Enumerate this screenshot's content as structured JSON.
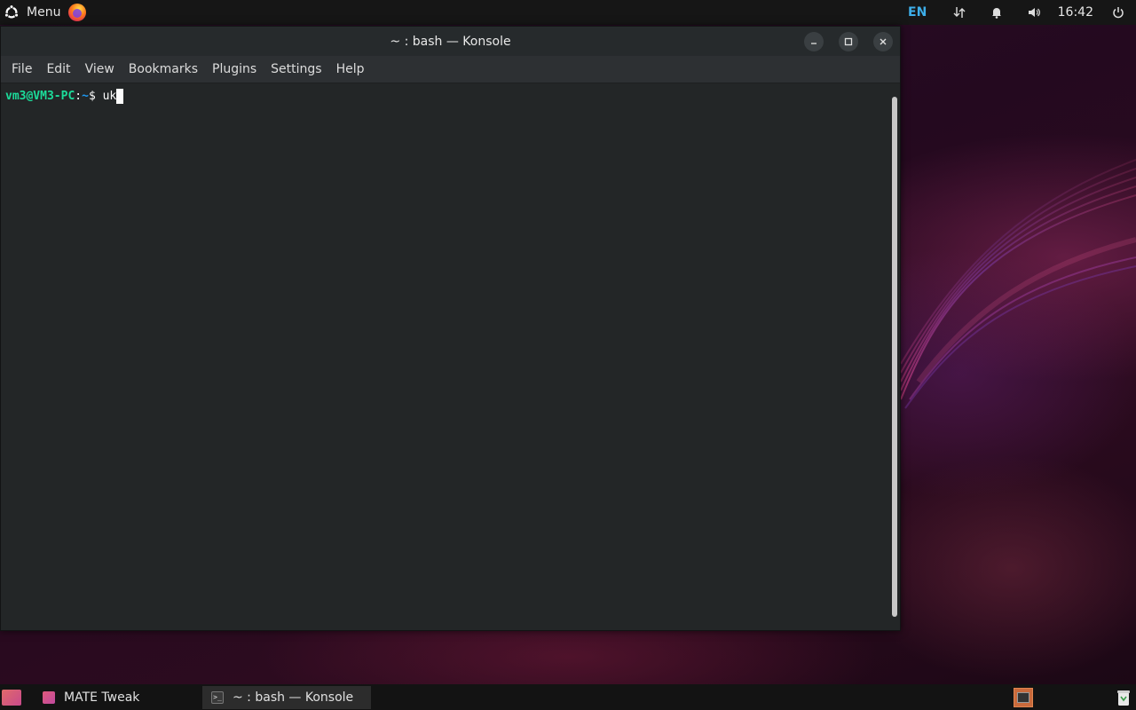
{
  "top_panel": {
    "menu_label": "Menu",
    "keyboard_layout": "EN",
    "clock": "16:42"
  },
  "window": {
    "title": "~ : bash — Konsole",
    "menus": [
      "File",
      "Edit",
      "View",
      "Bookmarks",
      "Plugins",
      "Settings",
      "Help"
    ]
  },
  "terminal": {
    "user_host": "vm3@VM3-PC",
    "separator": ":",
    "path": "~",
    "symbol": "$ ",
    "input": "uk"
  },
  "taskbar": {
    "tasks": [
      {
        "label": "MATE Tweak"
      },
      {
        "label": "~ : bash — Konsole"
      }
    ]
  },
  "colors": {
    "prompt_user": "#1cdc9a",
    "prompt_path": "#1d99f3",
    "terminal_bg": "#232627",
    "accent": "#3daee9"
  }
}
